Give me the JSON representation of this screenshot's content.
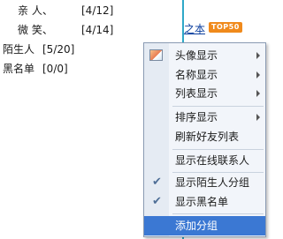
{
  "contacts": [
    {
      "name": "亲  人、",
      "count": "[4/12]"
    },
    {
      "name": "微  笑、",
      "count": "[4/14]"
    },
    {
      "name": "陌生人",
      "count": "[5/20]"
    },
    {
      "name": "黑名单",
      "count": "[0/0]"
    }
  ],
  "right_panel": {
    "link_text": "之本",
    "badge": "TOP50"
  },
  "context_menu": {
    "items": [
      {
        "label": "头像显示",
        "submenu": true
      },
      {
        "label": "名称显示",
        "submenu": true
      },
      {
        "label": "列表显示",
        "submenu": true
      },
      {
        "label": "排序显示",
        "submenu": true
      },
      {
        "label": "刷新好友列表"
      },
      {
        "label": "显示在线联系人"
      },
      {
        "label": "显示陌生人分组",
        "checked": true
      },
      {
        "label": "显示黑名单",
        "checked": true
      },
      {
        "label": "添加分组",
        "highlighted": true
      }
    ]
  },
  "colors": {
    "highlight": "#3b78d3",
    "menu_bg": "#f2f5fa",
    "badge": "#f08a1c"
  }
}
